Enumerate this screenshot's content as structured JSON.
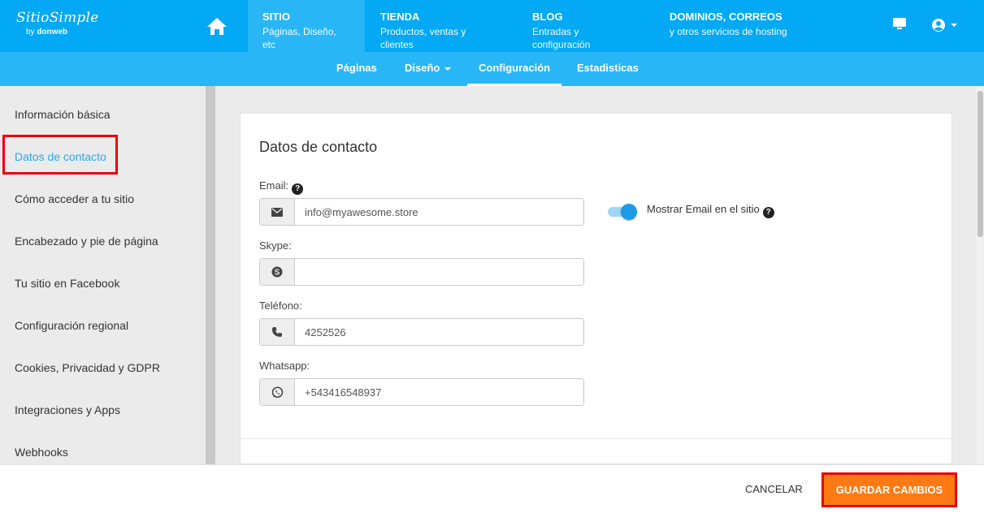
{
  "brand": {
    "name": "SitioSimple",
    "sub_prefix": "by ",
    "sub_brand": "donweb"
  },
  "topnav": [
    {
      "title": "SITIO",
      "subtitle": "Páginas, Diseño, etc"
    },
    {
      "title": "TIENDA",
      "subtitle": "Productos, ventas y clientes"
    },
    {
      "title": "BLOG",
      "subtitle": "Entradas y configuración"
    },
    {
      "title": "DOMINIOS, CORREOS",
      "subtitle": "y otros servicios de hosting"
    }
  ],
  "subnav": [
    "Páginas",
    "Diseño",
    "Configuración",
    "Estadisticas"
  ],
  "sidebar": [
    "Información básica",
    "Datos de contacto",
    "Cómo acceder a tu sitio",
    "Encabezado y pie de página",
    "Tu sitio en Facebook",
    "Configuración regional",
    "Cookies, Privacidad y GDPR",
    "Integraciones y Apps",
    "Webhooks"
  ],
  "form": {
    "title": "Datos de contacto",
    "email_label": "Email:",
    "email_value": "info@myawesome.store",
    "show_email_label": "Mostrar Email en el sitio",
    "show_email_on": true,
    "skype_label": "Skype:",
    "skype_value": "",
    "phone_label": "Teléfono:",
    "phone_value": "4252526",
    "whatsapp_label": "Whatsapp:",
    "whatsapp_value": "+543416548937"
  },
  "footer": {
    "cancel": "CANCELAR",
    "save": "GUARDAR CAMBIOS"
  },
  "colors": {
    "primary": "#03a9f4",
    "subnav": "#29b6f6",
    "save": "#ff7a12",
    "highlight": "#e8000b",
    "active_link": "#29a8e8"
  }
}
